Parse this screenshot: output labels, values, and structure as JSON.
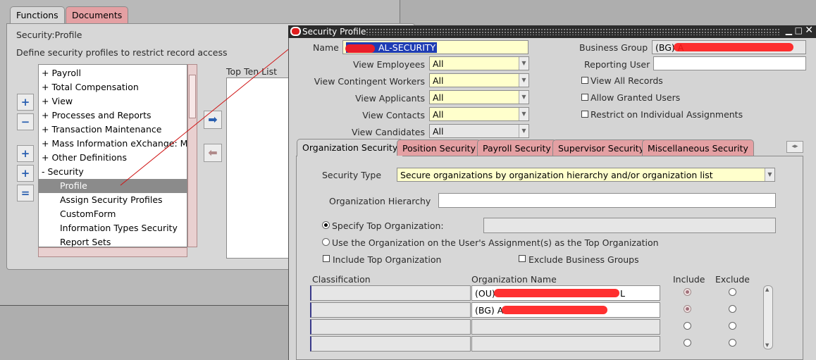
{
  "navigator": {
    "tabs": [
      "Functions",
      "Documents"
    ],
    "title": "Security:Profile",
    "description": "Define security profiles to restrict record access",
    "tree_items": [
      {
        "label": "+  Payroll"
      },
      {
        "label": "+  Total Compensation"
      },
      {
        "label": "+  View"
      },
      {
        "label": "+  Processes and Reports"
      },
      {
        "label": "+  Transaction Maintenance"
      },
      {
        "label": "+  Mass Information eXchange: MIX"
      },
      {
        "label": "+  Other Definitions"
      },
      {
        "label": "-  Security"
      },
      {
        "label": "Profile"
      },
      {
        "label": "Assign Security Profiles"
      },
      {
        "label": "CustomForm"
      },
      {
        "label": "Information Types Security"
      },
      {
        "label": "Report Sets"
      }
    ],
    "top_ten_label": "Top Ten List"
  },
  "window": {
    "title": "Security Profile",
    "name_label": "Name",
    "name_value": "AL-SECURITY",
    "business_group_label": "Business Group",
    "business_group_value": "(BG) A",
    "reporting_user_label": "Reporting User",
    "reporting_user_value": "",
    "views": [
      {
        "label": "View Employees",
        "value": "All"
      },
      {
        "label": "View Contingent Workers",
        "value": "All"
      },
      {
        "label": "View Applicants",
        "value": "All"
      },
      {
        "label": "View Contacts",
        "value": "All"
      },
      {
        "label": "View Candidates",
        "value": "All"
      }
    ],
    "checkboxes": {
      "view_all_records": "View All Records",
      "allow_granted_users": "Allow Granted Users",
      "restrict_individual": "Restrict on Individual Assignments"
    },
    "tabs": [
      "Organization Security",
      "Position Security",
      "Payroll Security",
      "Supervisor Security",
      "Miscellaneous Security"
    ],
    "org": {
      "security_type_label": "Security Type",
      "security_type_value": "Secure organizations by organization hierarchy and/or organization list",
      "hierarchy_label": "Organization Hierarchy",
      "hierarchy_value": "",
      "specify_top_label": "Specify Top Organization:",
      "use_assignment_label": "Use the Organization on the User's Assignment(s) as the Top Organization",
      "include_top_label": "Include Top Organization",
      "exclude_bg_label": "Exclude Business Groups",
      "col_classification": "Classification",
      "col_org_name": "Organization Name",
      "col_include": "Include",
      "col_exclude": "Exclude",
      "rows": [
        {
          "classification": "",
          "org_name": "(OU)",
          "org_name_tail": "L"
        },
        {
          "classification": "",
          "org_name": "(BG) A",
          "org_name_tail": ""
        },
        {
          "classification": "",
          "org_name": "",
          "org_name_tail": ""
        },
        {
          "classification": "",
          "org_name": "",
          "org_name_tail": ""
        }
      ]
    }
  },
  "colors": {
    "required_field": "#ffffcc",
    "inactive_tab": "#e4a0a3",
    "titlebar": "#2b2b2b",
    "selection": "#1e3cb4",
    "redaction": "#ff1a1a"
  }
}
